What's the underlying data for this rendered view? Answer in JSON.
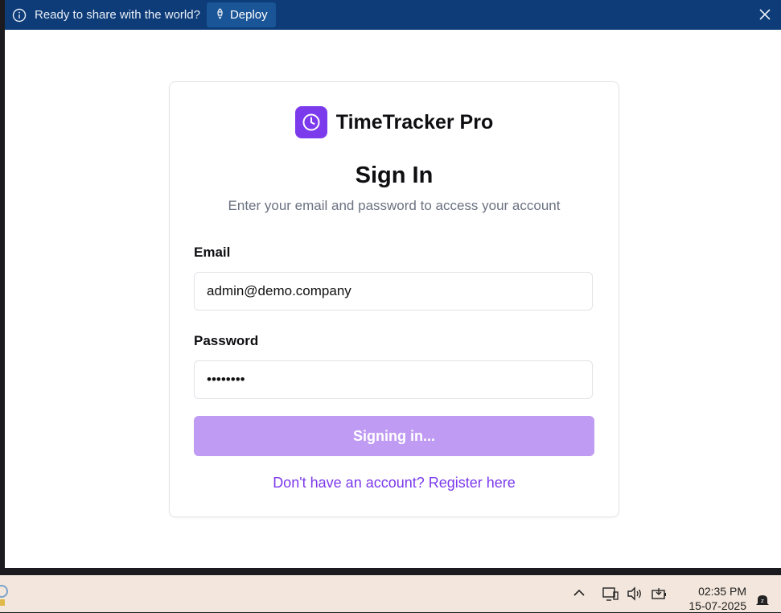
{
  "banner": {
    "message": "Ready to share with the world?",
    "deploy_label": "Deploy"
  },
  "app": {
    "name": "TimeTracker Pro",
    "logo_icon": "clock-icon",
    "accent_color": "#7c3aed"
  },
  "signin": {
    "title": "Sign In",
    "subtitle": "Enter your email and password to access your account",
    "email_label": "Email",
    "email_value": "admin@demo.company",
    "password_label": "Password",
    "password_value": "demopass",
    "submit_label": "Signing in...",
    "register_text": "Don't have an account? Register here"
  },
  "taskbar": {
    "time": "02:35 PM",
    "date": "15-07-2025"
  }
}
